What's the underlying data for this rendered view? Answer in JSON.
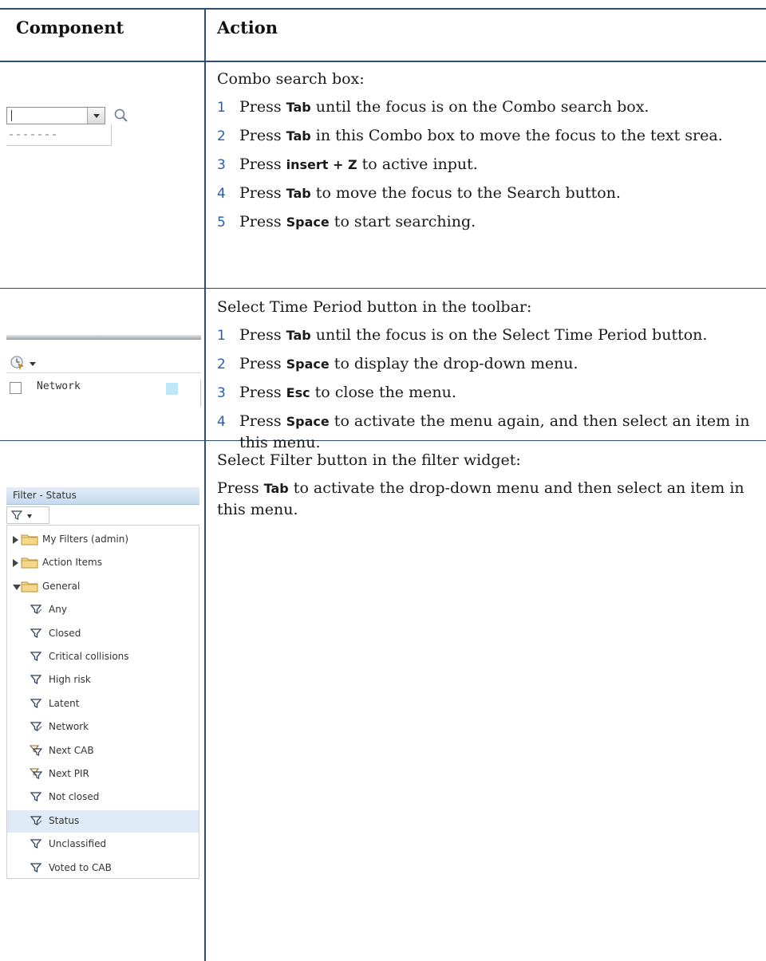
{
  "table": {
    "header_component": "Component",
    "header_action": "Action"
  },
  "rows": [
    {
      "intro": "Combo search box:",
      "steps": [
        {
          "num": "1",
          "pre": "Press ",
          "key": "Tab",
          "post": " until the focus is on the Combo search box."
        },
        {
          "num": "2",
          "pre": "Press ",
          "key": "Tab",
          "post": " in this Combo box to move the focus to the text srea."
        },
        {
          "num": "3",
          "pre": "Press ",
          "key": "insert + Z",
          "post": " to active input."
        },
        {
          "num": "4",
          "pre": "Press ",
          "key": "Tab",
          "post": " to move the focus to the Search button."
        },
        {
          "num": "5",
          "pre": "Press ",
          "key": "Space",
          "post": " to start searching."
        }
      ]
    },
    {
      "intro": "Select Time Period button in the toolbar:",
      "steps": [
        {
          "num": "1",
          "pre": "Press ",
          "key": "Tab",
          "post": " until the focus is on the Select Time Period button."
        },
        {
          "num": "2",
          "pre": "Press ",
          "key": "Space",
          "post": " to display the drop-down menu."
        },
        {
          "num": "3",
          "pre": "Press ",
          "key": "Esc",
          "post": " to close the menu."
        },
        {
          "num": "4",
          "pre": "Press ",
          "key": "Space",
          "post": " to activate the menu again, and then select an item in this menu."
        }
      ]
    },
    {
      "intro": "Select Filter button in the filter widget:",
      "para_pre": "Press ",
      "para_key": "Tab",
      "para_post": " to activate the drop-down menu and then select an item in this menu."
    }
  ],
  "time_period_widget": {
    "item_label": "Network",
    "swatch_color": "#bfe6f8"
  },
  "filter_widget": {
    "title": "Filter - Status",
    "tree": [
      {
        "label": "My Filters (admin)",
        "kind": "folder",
        "expanded": false
      },
      {
        "label": "Action Items",
        "kind": "folder",
        "expanded": false
      },
      {
        "label": "General",
        "kind": "folder",
        "expanded": true
      },
      {
        "label": "Any",
        "kind": "filter-edit"
      },
      {
        "label": "Closed",
        "kind": "filter"
      },
      {
        "label": "Critical collisions",
        "kind": "filter"
      },
      {
        "label": "High risk",
        "kind": "filter"
      },
      {
        "label": "Latent",
        "kind": "filter"
      },
      {
        "label": "Network",
        "kind": "filter-edit"
      },
      {
        "label": "Next CAB",
        "kind": "filter-shared"
      },
      {
        "label": "Next PIR",
        "kind": "filter-shared"
      },
      {
        "label": "Not closed",
        "kind": "filter"
      },
      {
        "label": "Status",
        "kind": "filter-edit",
        "selected": true
      },
      {
        "label": "Unclassified",
        "kind": "filter"
      },
      {
        "label": "Voted to CAB",
        "kind": "filter"
      }
    ]
  },
  "colors": {
    "rule": "#2f4d6e",
    "step_number": "#2a5da8",
    "selection": "#dfeaf7"
  }
}
